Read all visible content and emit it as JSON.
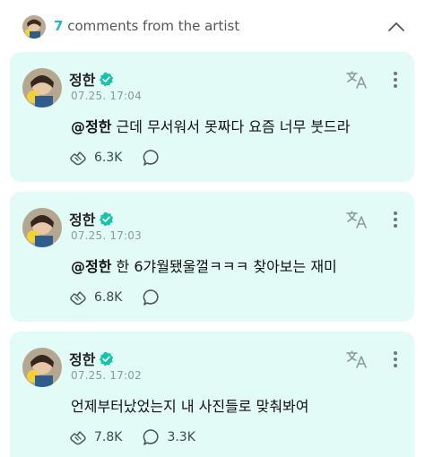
{
  "header": {
    "count": "7",
    "label": " comments from the artist"
  },
  "comments": [
    {
      "author": "정한",
      "time": "07.25. 17:04",
      "mention": "@정한",
      "text": " 근데 무서워서 못짜다 요즘 너무 붓드라",
      "likes": "6.3K",
      "replies": ""
    },
    {
      "author": "정한",
      "time": "07.25. 17:03",
      "mention": "@정한",
      "text": " 한 6갸월됐울껄ㅋㅋㅋ 찾아보는 재미",
      "likes": "6.8K",
      "replies": ""
    },
    {
      "author": "정한",
      "time": "07.25. 17:02",
      "mention": "",
      "text": "언제부터났었는지 내 사진들로 맞춰봐여",
      "likes": "7.8K",
      "replies": "3.3K"
    }
  ],
  "colors": {
    "accent": "#1fb8c6",
    "card_bg": "#e2fbf6",
    "verified": "#18c3ad"
  },
  "icons": [
    "chevron-up-icon",
    "verified-icon",
    "translate-icon",
    "more-icon",
    "like-icon",
    "comment-icon"
  ]
}
